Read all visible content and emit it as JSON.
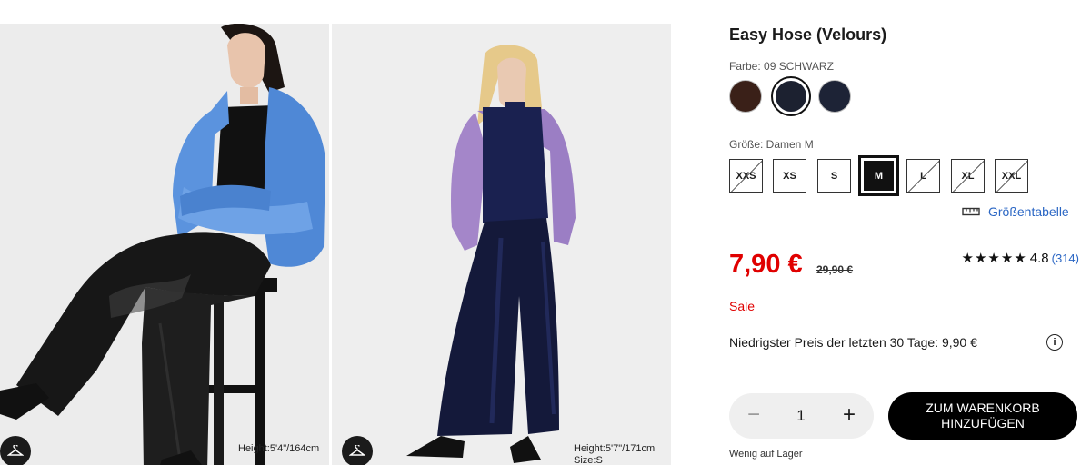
{
  "gallery": {
    "images": [
      {
        "alt": "model-seated",
        "model_info": "Height:5'4\"/164cm"
      },
      {
        "alt": "model-standing",
        "model_info_lines": [
          "Height:5'7\"/171cm",
          "Size:S"
        ]
      }
    ]
  },
  "product": {
    "title": "Easy Hose (Velours)",
    "color_label": "Farbe: 09 SCHWARZ",
    "colors": [
      {
        "name": "brown",
        "hex": "#3a2018",
        "selected": false
      },
      {
        "name": "black",
        "hex": "#1c2130",
        "selected": true
      },
      {
        "name": "navy",
        "hex": "#1d2336",
        "selected": false
      }
    ],
    "size_label": "Größe: Damen M",
    "sizes": [
      {
        "label": "XXS",
        "available": false,
        "selected": false
      },
      {
        "label": "XS",
        "available": true,
        "selected": false
      },
      {
        "label": "S",
        "available": true,
        "selected": false
      },
      {
        "label": "M",
        "available": true,
        "selected": true
      },
      {
        "label": "L",
        "available": false,
        "selected": false
      },
      {
        "label": "XL",
        "available": false,
        "selected": false
      },
      {
        "label": "XXL",
        "available": false,
        "selected": false
      }
    ],
    "size_chart_label": "Größentabelle",
    "price": "7,90 €",
    "old_price": "29,90 €",
    "rating": {
      "stars": "★★★★★",
      "value": "4.8",
      "count": "(314)"
    },
    "sale_label": "Sale",
    "lowest_price_text": "Niedrigster Preis der letzten 30 Tage: 9,90 €",
    "quantity": {
      "minus": "−",
      "value": "1",
      "plus": "+"
    },
    "cart_button_label": "ZUM WARENKORB HINZUFÜGEN",
    "stock_text": "Wenig auf Lager"
  },
  "colors": {
    "sale_red": "#e00000",
    "link_blue": "#2a66c4"
  }
}
